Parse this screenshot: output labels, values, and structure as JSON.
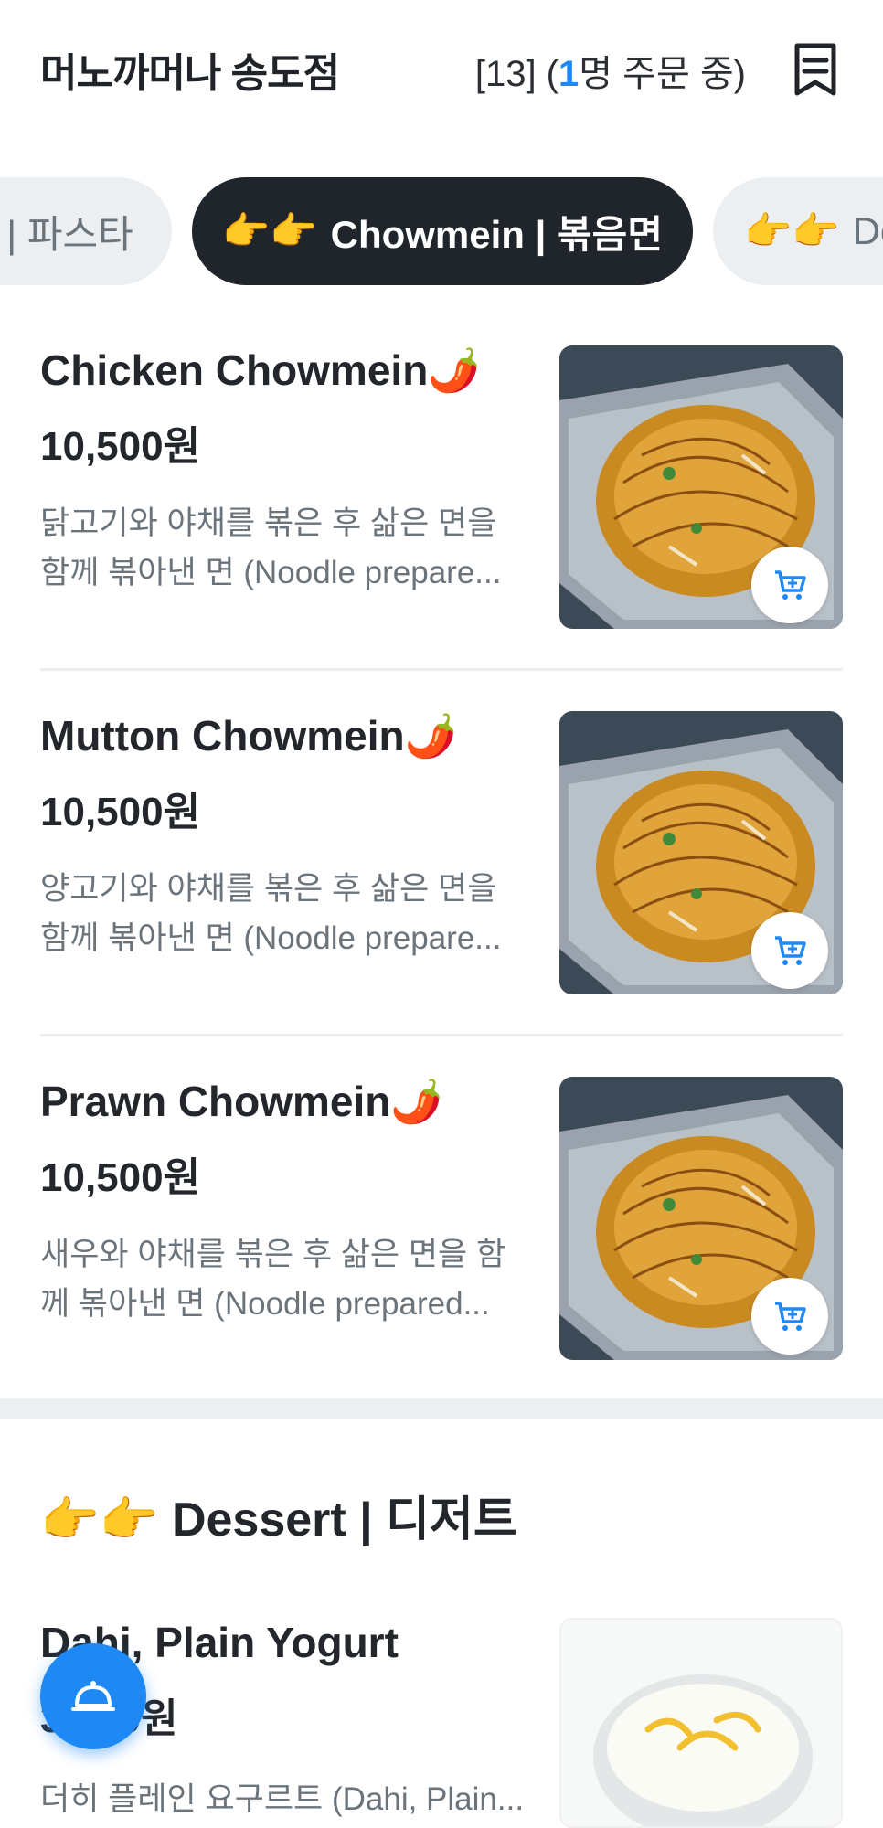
{
  "header": {
    "store_name": "머노까머나 송도점",
    "table_prefix": "[13] (",
    "order_count": "1",
    "order_suffix": "명 주문 중)",
    "receipt_icon": "receipt-icon"
  },
  "tabs": [
    {
      "emoji": "",
      "label": "n | 파스타",
      "active": false
    },
    {
      "emoji": "👉👉",
      "label": "Chowmein | 볶음면",
      "active": true
    },
    {
      "emoji": "👉👉",
      "label": "De",
      "active": false
    }
  ],
  "items": [
    {
      "name": "Chicken Chowmein🌶️",
      "price": "10,500원",
      "desc_line1": "닭고기와 야채를 볶은 후 삶은 면을",
      "desc_line2": "함께 볶아낸 면 (Noodle prepare...",
      "cart_icon": "add-to-cart-icon"
    },
    {
      "name": "Mutton Chowmein🌶️",
      "price": "10,500원",
      "desc_line1": "양고기와 야채를 볶은 후 삶은 면을",
      "desc_line2": "함께 볶아낸 면 (Noodle prepare...",
      "cart_icon": "add-to-cart-icon"
    },
    {
      "name": "Prawn Chowmein🌶️",
      "price": "10,500원",
      "desc_line1": "새우와 야채를 볶은 후 삶은 면을 함",
      "desc_line2": "께 볶아낸 면 (Noodle prepared...",
      "cart_icon": "add-to-cart-icon"
    }
  ],
  "dessert_section": {
    "title": "👉👉 Dessert | 디저트",
    "item": {
      "name": "Dahi, Plain Yogurt",
      "price": "3,500원",
      "desc": "더히 플레인 요구르트 (Dahi, Plain..."
    }
  },
  "fab": {
    "icon": "server-bell-icon"
  },
  "colors": {
    "accent": "#1e88f5",
    "active_tab": "#1f252a",
    "inactive_tab": "#eceff1",
    "muted_text": "#6b737b"
  }
}
